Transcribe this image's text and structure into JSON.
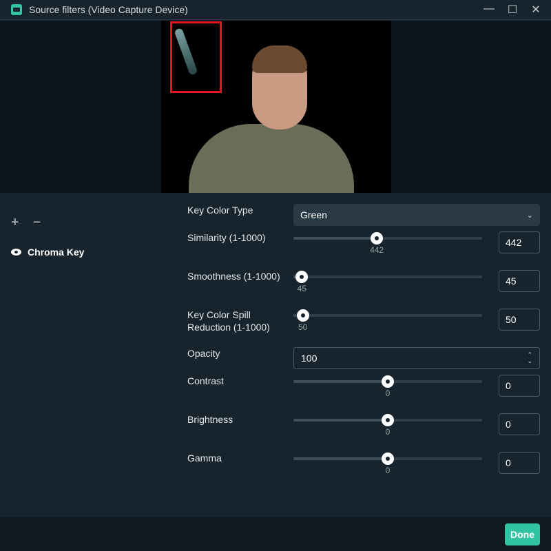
{
  "window": {
    "title": "Source filters (Video Capture Device)"
  },
  "filters": [
    {
      "name": "Chroma Key",
      "visible": true
    }
  ],
  "settings": {
    "key_color_type": {
      "label": "Key Color Type",
      "value": "Green"
    },
    "similarity": {
      "label": "Similarity (1-1000)",
      "value": "442",
      "level": 0.442
    },
    "smoothness": {
      "label": "Smoothness (1-1000)",
      "value": "45",
      "level": 0.045
    },
    "spill": {
      "label": "Key Color Spill Reduction (1-1000)",
      "value": "50",
      "level": 0.05
    },
    "opacity": {
      "label": "Opacity",
      "value": "100"
    },
    "contrast": {
      "label": "Contrast",
      "value": "0",
      "level": 0.5
    },
    "brightness": {
      "label": "Brightness",
      "value": "0",
      "level": 0.5
    },
    "gamma": {
      "label": "Gamma",
      "value": "0",
      "level": 0.5
    }
  },
  "footer": {
    "done": "Done"
  },
  "colors": {
    "accent": "#31c3a2",
    "background": "#17242d",
    "highlight_box": "#e5141d"
  }
}
